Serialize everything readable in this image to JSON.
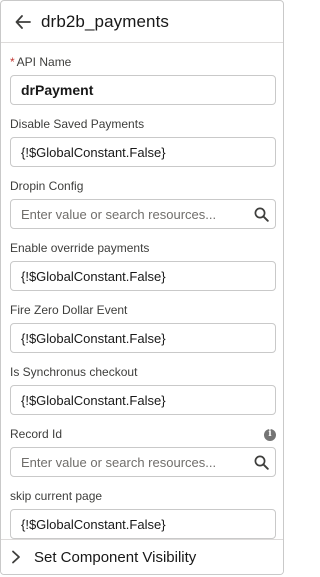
{
  "header": {
    "title": "drb2b_payments"
  },
  "fields": [
    {
      "label": "API Name",
      "value": "drPayment",
      "required": true
    },
    {
      "label": "Disable Saved Payments",
      "value": "{!$GlobalConstant.False}"
    },
    {
      "label": "Dropin Config",
      "placeholder": "Enter value or search resources..."
    },
    {
      "label": "Enable override payments",
      "value": "{!$GlobalConstant.False}"
    },
    {
      "label": "Fire Zero Dollar Event",
      "value": "{!$GlobalConstant.False}"
    },
    {
      "label": "Is Synchronus checkout",
      "value": "{!$GlobalConstant.False}"
    },
    {
      "label": "Record Id",
      "placeholder": "Enter value or search resources..."
    },
    {
      "label": "skip current page",
      "value": "{!$GlobalConstant.False}"
    }
  ],
  "required_marker": "*",
  "info_icon_glyph": "i",
  "footer": {
    "label": "Set Component Visibility"
  }
}
